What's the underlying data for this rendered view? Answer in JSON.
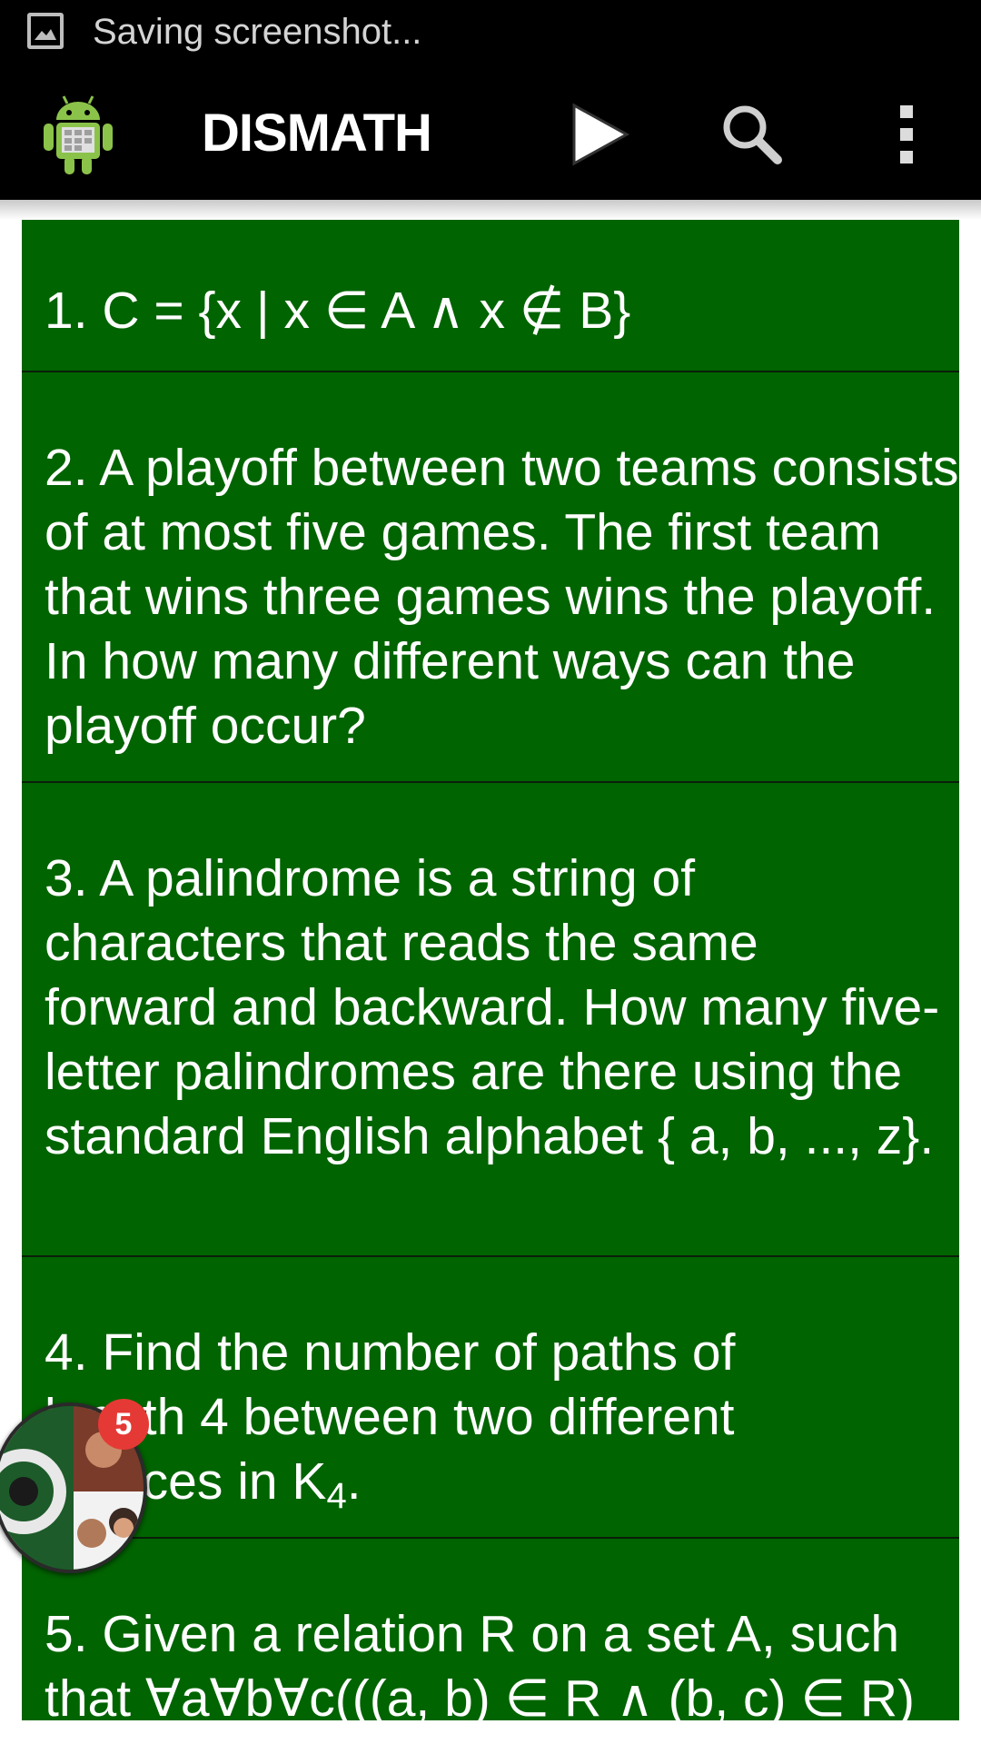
{
  "status_bar": {
    "icon": "screenshot-icon",
    "text": "Saving screenshot..."
  },
  "action_bar": {
    "title": "DISMATH",
    "icons": [
      "android-app-icon",
      "play-icon",
      "search-icon",
      "overflow-menu-icon"
    ]
  },
  "questions": [
    {
      "text": "1. C = {x | x ∈ A ∧ x ∉ B}"
    },
    {
      "text": "2. A playoff between two teams consists of at most five games. The first team that wins three games wins the playoff. In how many different ways can the playoff occur?"
    },
    {
      "text": "3. A palindrome is a string of characters that reads the same forward and backward. How many five-letter palindromes are there using the standard English alphabet { a, b, ..., z}."
    },
    {
      "text_main": "4. Find the number of paths of length 4 between two different vertices in K",
      "text_sub": "4",
      "text_end": "."
    },
    {
      "text": "5. Given a relation R on a set A, such that ∀a∀b∀c(((a, b) ∈ R ∧ (b, c) ∈ R)"
    }
  ],
  "chat_head": {
    "badge_count": "5"
  },
  "colors": {
    "list_bg": "#006400",
    "bar_bg": "#000000",
    "badge": "#e53935"
  }
}
